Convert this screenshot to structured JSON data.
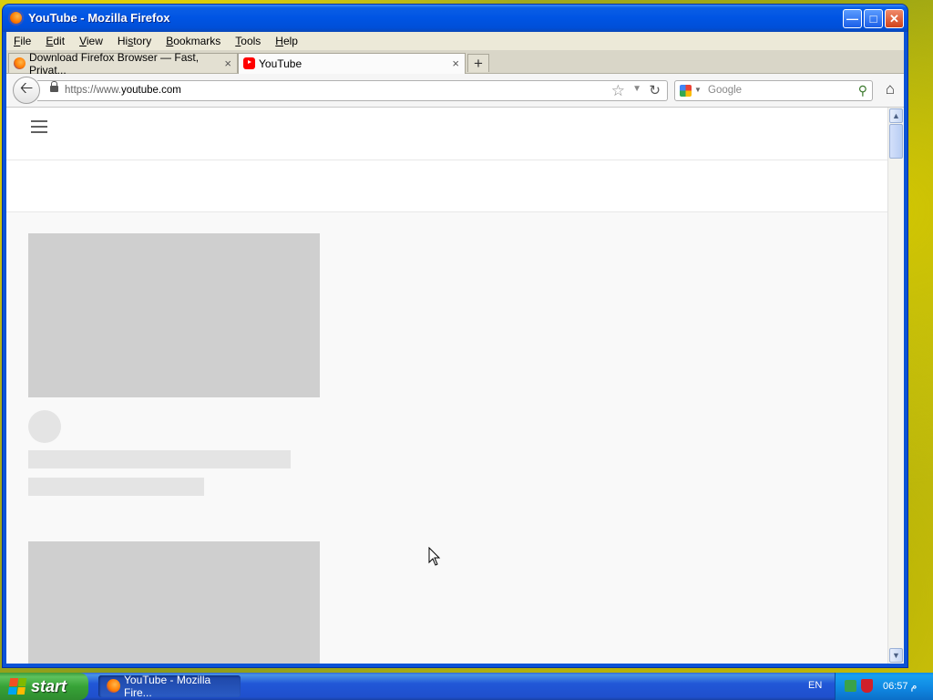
{
  "window": {
    "title": "YouTube - Mozilla Firefox"
  },
  "menu": [
    "File",
    "Edit",
    "View",
    "History",
    "Bookmarks",
    "Tools",
    "Help"
  ],
  "menu_access_keys": [
    "F",
    "E",
    "V",
    "H",
    "B",
    "T",
    "H"
  ],
  "tabs": [
    {
      "label": "Download Firefox Browser — Fast, Privat...",
      "favicon": "firefox-icon",
      "active": false
    },
    {
      "label": "YouTube",
      "favicon": "youtube-icon",
      "active": true
    }
  ],
  "navbar": {
    "url_prefix": "https://www.",
    "url_domain": "youtube.com",
    "search_placeholder": "Google"
  },
  "taskbar": {
    "start_label": "start",
    "task_label": "YouTube - Mozilla Fire...",
    "language": "EN",
    "clock": "06:57 م"
  },
  "colors": {
    "titlebar": "#0054e3",
    "skeleton_thumb": "#cfcfcf",
    "skeleton_text": "#e4e4e4",
    "start_button": "#37a337"
  }
}
